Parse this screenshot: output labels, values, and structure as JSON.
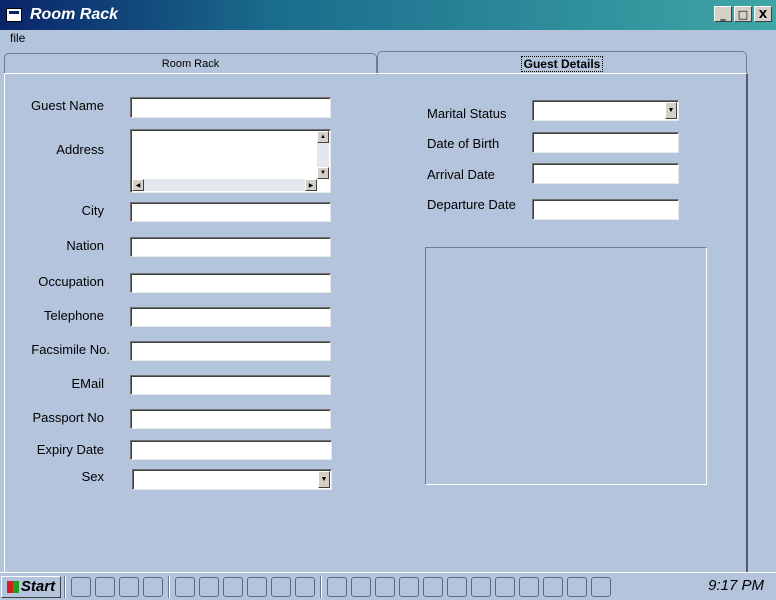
{
  "window": {
    "title": "Room Rack",
    "minimize_label": "_",
    "maximize_label": "□",
    "close_label": "X"
  },
  "menu": {
    "file": "file"
  },
  "tabs": {
    "room_rack": "Room Rack",
    "guest_details": "Guest Details"
  },
  "form_left": {
    "guest_name": {
      "label": "Guest Name",
      "value": ""
    },
    "address": {
      "label": "Address",
      "value": ""
    },
    "city": {
      "label": "City",
      "value": ""
    },
    "nation": {
      "label": "Nation",
      "value": ""
    },
    "occupation": {
      "label": "Occupation",
      "value": ""
    },
    "telephone": {
      "label": "Telephone",
      "value": ""
    },
    "facsimile": {
      "label": "Facsimile No.",
      "value": ""
    },
    "email": {
      "label": "EMail",
      "value": ""
    },
    "passport": {
      "label": "Passport No",
      "value": ""
    },
    "expiry": {
      "label": "Expiry Date",
      "value": ""
    },
    "sex": {
      "label": "Sex",
      "value": ""
    }
  },
  "form_right": {
    "marital_status": {
      "label": "Marital Status",
      "value": ""
    },
    "date_of_birth": {
      "label": "Date of Birth",
      "value": ""
    },
    "arrival_date": {
      "label": "Arrival Date",
      "value": ""
    },
    "departure_date": {
      "label": "Departure Date",
      "value": ""
    }
  },
  "taskbar": {
    "start_label": "Start",
    "clock": "9:17 PM"
  }
}
